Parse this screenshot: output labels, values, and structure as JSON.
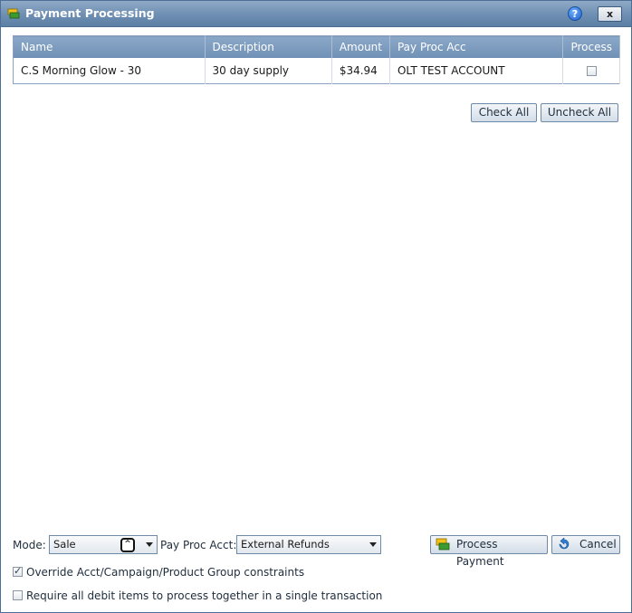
{
  "window": {
    "title": "Payment Processing",
    "help_label": "?",
    "close_label": "x"
  },
  "grid": {
    "columns": [
      "Name",
      "Description",
      "Amount",
      "Pay Proc Acc",
      "Process"
    ],
    "rows": [
      {
        "name": "C.S Morning Glow - 30",
        "description": "30 day supply",
        "amount": "$34.94",
        "pay_proc_acc": "OLT TEST ACCOUNT",
        "process": false
      }
    ]
  },
  "buttons": {
    "check_all": "Check All",
    "uncheck_all": "Uncheck All",
    "process_payment": "Process Payment",
    "cancel": "Cancel"
  },
  "mode": {
    "label": "Mode:",
    "value": "Sale"
  },
  "pay_proc_acct": {
    "label": "Pay Proc Acct:",
    "value": "External Refunds"
  },
  "options": {
    "override": {
      "label": "Override Acct/Campaign/Product Group constraints",
      "checked": true
    },
    "require_all": {
      "label": "Require all debit items to process together in a single transaction",
      "checked": false
    }
  },
  "colors": {
    "titlebar": "#6e8fb2",
    "header": "#7b9abd",
    "accent_green": "#3c9a2e",
    "accent_yellow": "#f2c21b"
  }
}
